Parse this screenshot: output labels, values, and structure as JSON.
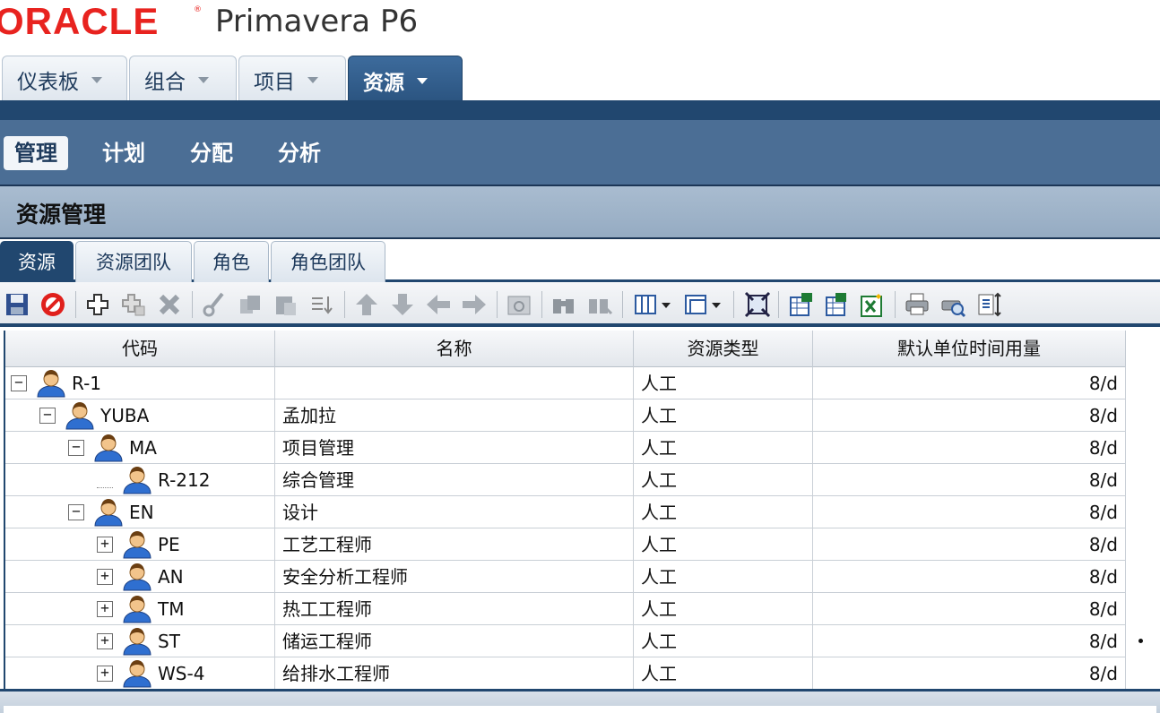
{
  "header": {
    "brand": "ORACLE",
    "product": "Primavera P6"
  },
  "top_tabs": [
    {
      "label": "仪表板",
      "active": false
    },
    {
      "label": "组合",
      "active": false
    },
    {
      "label": "项目",
      "active": false
    },
    {
      "label": "资源",
      "active": true
    }
  ],
  "subnav": [
    {
      "label": "管理",
      "active": true
    },
    {
      "label": "计划",
      "active": false
    },
    {
      "label": "分配",
      "active": false
    },
    {
      "label": "分析",
      "active": false
    }
  ],
  "section_title": "资源管理",
  "sub_tabs": [
    {
      "label": "资源",
      "active": true
    },
    {
      "label": "资源团队",
      "active": false
    },
    {
      "label": "角色",
      "active": false
    },
    {
      "label": "角色团队",
      "active": false
    }
  ],
  "toolbar": [
    "save-icon",
    "cancel-icon",
    "add-icon",
    "add-child-icon",
    "delete-icon",
    "cut-icon",
    "copy-icon",
    "paste-icon",
    "sort-icon",
    "move-up-icon",
    "move-down-icon",
    "move-left-icon",
    "move-right-icon",
    "calendar-icon",
    "find-icon",
    "find-next-icon",
    "columns-icon",
    "layout-icon",
    "fit-icon",
    "export-excel-icon",
    "import-excel-icon",
    "excel-icon",
    "print-icon",
    "print-preview-icon",
    "page-setup-icon"
  ],
  "grid": {
    "columns": [
      "代码",
      "名称",
      "资源类型",
      "默认单位时间用量"
    ],
    "rows": [
      {
        "code": "R-1",
        "name": "",
        "type": "人工",
        "units": "8/d",
        "level": 0,
        "toggle": "−"
      },
      {
        "code": "YUBA",
        "name": "孟加拉",
        "type": "人工",
        "units": "8/d",
        "level": 1,
        "toggle": "−"
      },
      {
        "code": "MA",
        "name": "项目管理",
        "type": "人工",
        "units": "8/d",
        "level": 2,
        "toggle": "−"
      },
      {
        "code": "R-212",
        "name": "综合管理",
        "type": "人工",
        "units": "8/d",
        "level": 3,
        "toggle": ""
      },
      {
        "code": "EN",
        "name": "设计",
        "type": "人工",
        "units": "8/d",
        "level": 2,
        "toggle": "−"
      },
      {
        "code": "PE",
        "name": "工艺工程师",
        "type": "人工",
        "units": "8/d",
        "level": 3,
        "toggle": "+"
      },
      {
        "code": "AN",
        "name": "安全分析工程师",
        "type": "人工",
        "units": "8/d",
        "level": 3,
        "toggle": "+"
      },
      {
        "code": "TM",
        "name": "热工工程师",
        "type": "人工",
        "units": "8/d",
        "level": 3,
        "toggle": "+"
      },
      {
        "code": "ST",
        "name": "储运工程师",
        "type": "人工",
        "units": "8/d",
        "level": 3,
        "toggle": "+"
      },
      {
        "code": "WS-4",
        "name": "给排水工程师",
        "type": "人工",
        "units": "8/d",
        "level": 3,
        "toggle": "+"
      }
    ]
  },
  "colors": {
    "brand_red": "#e8231f",
    "nav_blue": "#4b6e95",
    "dark_blue": "#21476f"
  }
}
